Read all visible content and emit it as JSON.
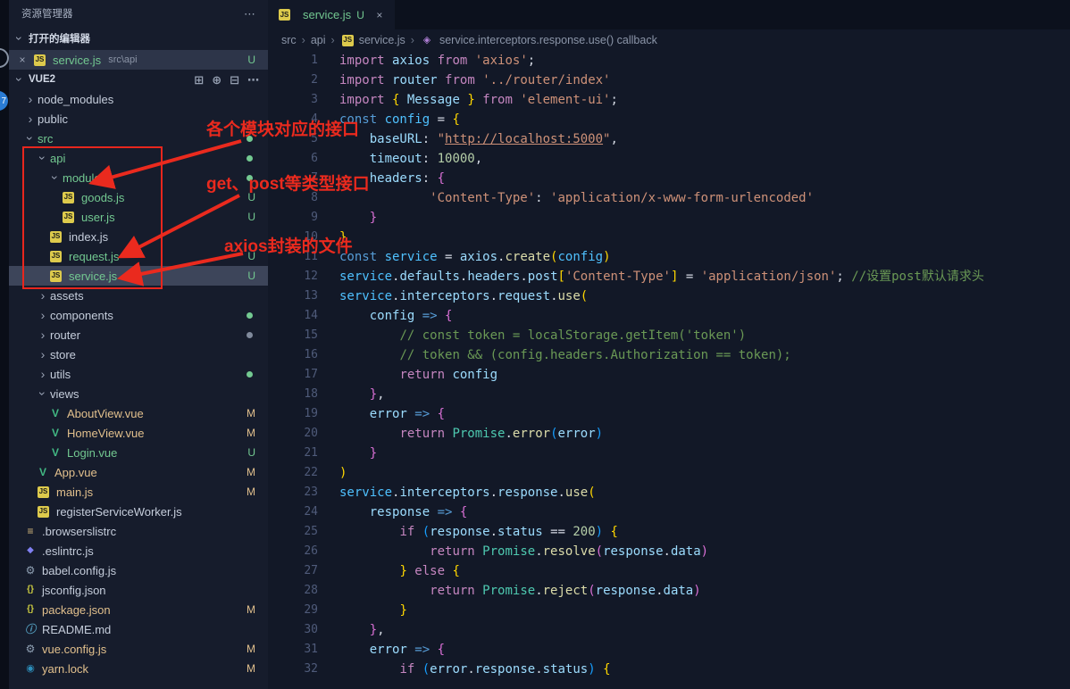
{
  "colors": {
    "annotation_red": "#ea2a1e",
    "git_untracked_green": "#73c991",
    "git_modified_gold": "#e2c08d",
    "selection_bg": "#3d455a",
    "js_icon_yellow": "#ddca4c",
    "vue_icon_green": "#42b883"
  },
  "activity_bar": {
    "badge": "7"
  },
  "icons": {
    "more": "⋯",
    "new_file": "⊞",
    "new_folder": "⊕",
    "collapse_folders": "⊟",
    "close": "×",
    "chevron": "›",
    "js_file": "JS",
    "vue_file": "V",
    "json_file": "{}",
    "gear_file": "⚙",
    "eslint_file": "◆",
    "list_file": "≡",
    "info_file": "ⓘ",
    "yarn_file": "◉",
    "symbol": "◈",
    "breadcrumb_sep": "›"
  },
  "sidebar": {
    "title": "资源管理器",
    "open_editors": {
      "label": "打开的编辑器",
      "items": [
        {
          "name": "service.js",
          "path": "src\\api",
          "badge": "U"
        }
      ]
    },
    "project": {
      "name": "VUE2",
      "tree": [
        {
          "depth": 0,
          "kind": "folder",
          "expanded": false,
          "label": "node_modules"
        },
        {
          "depth": 0,
          "kind": "folder",
          "expanded": false,
          "label": "public"
        },
        {
          "depth": 0,
          "kind": "folder",
          "expanded": true,
          "label": "src",
          "color": "green",
          "dot": "green"
        },
        {
          "depth": 1,
          "kind": "folder",
          "expanded": true,
          "label": "api",
          "color": "green",
          "dot": "green"
        },
        {
          "depth": 2,
          "kind": "folder",
          "expanded": true,
          "label": "modules",
          "color": "green",
          "dot": "green"
        },
        {
          "depth": 3,
          "kind": "file",
          "icon": "js_file",
          "label": "goods.js",
          "color": "green",
          "badge": "U"
        },
        {
          "depth": 3,
          "kind": "file",
          "icon": "js_file",
          "label": "user.js",
          "color": "green",
          "badge": "U"
        },
        {
          "depth": 2,
          "kind": "file",
          "icon": "js_file",
          "label": "index.js"
        },
        {
          "depth": 2,
          "kind": "file",
          "icon": "js_file",
          "label": "request.js",
          "color": "green",
          "badge": "U"
        },
        {
          "depth": 2,
          "kind": "file",
          "icon": "js_file",
          "label": "service.js",
          "color": "green",
          "badge": "U",
          "selected": true
        },
        {
          "depth": 1,
          "kind": "folder",
          "expanded": false,
          "label": "assets"
        },
        {
          "depth": 1,
          "kind": "folder",
          "expanded": false,
          "label": "components",
          "dot": "green"
        },
        {
          "depth": 1,
          "kind": "folder",
          "expanded": false,
          "label": "router",
          "dot": "grey"
        },
        {
          "depth": 1,
          "kind": "folder",
          "expanded": false,
          "label": "store"
        },
        {
          "depth": 1,
          "kind": "folder",
          "expanded": false,
          "label": "utils",
          "dot": "green"
        },
        {
          "depth": 1,
          "kind": "folder",
          "expanded": true,
          "label": "views"
        },
        {
          "depth": 2,
          "kind": "file",
          "icon": "vue_file",
          "label": "AboutView.vue",
          "color": "gold",
          "badge": "M"
        },
        {
          "depth": 2,
          "kind": "file",
          "icon": "vue_file",
          "label": "HomeView.vue",
          "color": "gold",
          "badge": "M"
        },
        {
          "depth": 2,
          "kind": "file",
          "icon": "vue_file",
          "label": "Login.vue",
          "color": "green",
          "badge": "U"
        },
        {
          "depth": 1,
          "kind": "file",
          "icon": "vue_file",
          "label": "App.vue",
          "color": "gold",
          "badge": "M"
        },
        {
          "depth": 1,
          "kind": "file",
          "icon": "js_file",
          "label": "main.js",
          "color": "gold",
          "badge": "M"
        },
        {
          "depth": 1,
          "kind": "file",
          "icon": "js_file",
          "label": "registerServiceWorker.js"
        },
        {
          "depth": 0,
          "kind": "file",
          "icon": "list_file",
          "label": ".browserslistrc"
        },
        {
          "depth": 0,
          "kind": "file",
          "icon": "eslint_file",
          "label": ".eslintrc.js"
        },
        {
          "depth": 0,
          "kind": "file",
          "icon": "gear_file",
          "label": "babel.config.js"
        },
        {
          "depth": 0,
          "kind": "file",
          "icon": "json_file",
          "label": "jsconfig.json"
        },
        {
          "depth": 0,
          "kind": "file",
          "icon": "json_file",
          "label": "package.json",
          "color": "gold",
          "badge": "M"
        },
        {
          "depth": 0,
          "kind": "file",
          "icon": "info_file",
          "label": "README.md"
        },
        {
          "depth": 0,
          "kind": "file",
          "icon": "gear_file",
          "label": "vue.config.js",
          "color": "gold",
          "badge": "M"
        },
        {
          "depth": 0,
          "kind": "file",
          "icon": "yarn_file",
          "label": "yarn.lock",
          "color": "gold",
          "badge": "M"
        }
      ]
    }
  },
  "annotations": [
    {
      "text": "各个模块对应的接口"
    },
    {
      "text": "get、post等类型接口"
    },
    {
      "text": "axios封装的文件"
    }
  ],
  "editor": {
    "tab": {
      "label": "service.js",
      "badge": "U"
    },
    "breadcrumbs": [
      {
        "label": "src"
      },
      {
        "label": "api"
      },
      {
        "label": "service.js",
        "icon": "js_file"
      },
      {
        "label": "service.interceptors.response.use() callback",
        "icon": "symbol"
      }
    ],
    "lines": [
      [
        [
          "import ",
          "kw"
        ],
        [
          "axios ",
          "var"
        ],
        [
          "from ",
          "kw"
        ],
        [
          "'axios'",
          "str"
        ],
        [
          ";",
          "pn"
        ]
      ],
      [
        [
          "import ",
          "kw"
        ],
        [
          "router ",
          "var"
        ],
        [
          "from ",
          "kw"
        ],
        [
          "'../router/index'",
          "str"
        ]
      ],
      [
        [
          "import ",
          "kw"
        ],
        [
          "{ ",
          "b1"
        ],
        [
          "Message",
          "var"
        ],
        [
          " } ",
          "b1"
        ],
        [
          "from ",
          "kw"
        ],
        [
          "'element-ui'",
          "str"
        ],
        [
          ";",
          "pn"
        ]
      ],
      [
        [
          "const ",
          "cd"
        ],
        [
          "config ",
          "cvar"
        ],
        [
          "= ",
          "pn"
        ],
        [
          "{",
          "b1"
        ]
      ],
      [
        [
          "    ",
          "pn"
        ],
        [
          "baseURL",
          "var"
        ],
        [
          ": ",
          "pn"
        ],
        [
          "\"",
          "str"
        ],
        [
          "http://localhost:5000",
          "link"
        ],
        [
          "\"",
          "str"
        ],
        [
          ",",
          "pn"
        ]
      ],
      [
        [
          "    ",
          "pn"
        ],
        [
          "timeout",
          "var"
        ],
        [
          ": ",
          "pn"
        ],
        [
          "10000",
          "num"
        ],
        [
          ",",
          "pn"
        ]
      ],
      [
        [
          "    ",
          "pn"
        ],
        [
          "headers",
          "var"
        ],
        [
          ": ",
          "pn"
        ],
        [
          "{",
          "b2"
        ]
      ],
      [
        [
          "            ",
          "pn"
        ],
        [
          "'Content-Type'",
          "str"
        ],
        [
          ": ",
          "pn"
        ],
        [
          "'application/x-www-form-urlencoded'",
          "str"
        ]
      ],
      [
        [
          "    ",
          "pn"
        ],
        [
          "}",
          "b2"
        ]
      ],
      [
        [
          "}",
          "b1"
        ]
      ],
      [
        [
          "const ",
          "cd"
        ],
        [
          "service ",
          "cvar"
        ],
        [
          "= ",
          "pn"
        ],
        [
          "axios",
          "var"
        ],
        [
          ".",
          "pn"
        ],
        [
          "create",
          "fn"
        ],
        [
          "(",
          "b1"
        ],
        [
          "config",
          "cvar"
        ],
        [
          ")",
          "b1"
        ]
      ],
      [
        [
          "service",
          "cvar"
        ],
        [
          ".",
          "pn"
        ],
        [
          "defaults",
          "var"
        ],
        [
          ".",
          "pn"
        ],
        [
          "headers",
          "var"
        ],
        [
          ".",
          "pn"
        ],
        [
          "post",
          "var"
        ],
        [
          "[",
          "b1"
        ],
        [
          "'Content-Type'",
          "str"
        ],
        [
          "]",
          "b1"
        ],
        [
          " = ",
          "pn"
        ],
        [
          "'application/json'",
          "str"
        ],
        [
          "; ",
          "pn"
        ],
        [
          "//设置post默认请求头",
          "cmt"
        ]
      ],
      [
        [
          "service",
          "cvar"
        ],
        [
          ".",
          "pn"
        ],
        [
          "interceptors",
          "var"
        ],
        [
          ".",
          "pn"
        ],
        [
          "request",
          "var"
        ],
        [
          ".",
          "pn"
        ],
        [
          "use",
          "fn"
        ],
        [
          "(",
          "b1"
        ]
      ],
      [
        [
          "    ",
          "pn"
        ],
        [
          "config ",
          "var"
        ],
        [
          "=> ",
          "cd"
        ],
        [
          "{",
          "b2"
        ]
      ],
      [
        [
          "        ",
          "pn"
        ],
        [
          "// const token = localStorage.getItem('token')",
          "cmt"
        ]
      ],
      [
        [
          "        ",
          "pn"
        ],
        [
          "// token && (config.headers.Authorization == token);",
          "cmt"
        ]
      ],
      [
        [
          "        ",
          "pn"
        ],
        [
          "return ",
          "kw"
        ],
        [
          "config",
          "var"
        ]
      ],
      [
        [
          "    ",
          "pn"
        ],
        [
          "}",
          "b2"
        ],
        [
          ",",
          "pn"
        ]
      ],
      [
        [
          "    ",
          "pn"
        ],
        [
          "error ",
          "var"
        ],
        [
          "=> ",
          "cd"
        ],
        [
          "{",
          "b2"
        ]
      ],
      [
        [
          "        ",
          "pn"
        ],
        [
          "return ",
          "kw"
        ],
        [
          "Promise",
          "cls"
        ],
        [
          ".",
          "pn"
        ],
        [
          "error",
          "fn"
        ],
        [
          "(",
          "b3"
        ],
        [
          "error",
          "var"
        ],
        [
          ")",
          "b3"
        ]
      ],
      [
        [
          "    ",
          "pn"
        ],
        [
          "}",
          "b2"
        ]
      ],
      [
        [
          ")",
          "b1"
        ]
      ],
      [
        [
          "service",
          "cvar"
        ],
        [
          ".",
          "pn"
        ],
        [
          "interceptors",
          "var"
        ],
        [
          ".",
          "pn"
        ],
        [
          "response",
          "var"
        ],
        [
          ".",
          "pn"
        ],
        [
          "use",
          "fn"
        ],
        [
          "(",
          "b1"
        ]
      ],
      [
        [
          "    ",
          "pn"
        ],
        [
          "response ",
          "var"
        ],
        [
          "=> ",
          "cd"
        ],
        [
          "{",
          "b2"
        ]
      ],
      [
        [
          "        ",
          "pn"
        ],
        [
          "if ",
          "kw"
        ],
        [
          "(",
          "b3"
        ],
        [
          "response",
          "var"
        ],
        [
          ".",
          "pn"
        ],
        [
          "status ",
          "var"
        ],
        [
          "== ",
          "pn"
        ],
        [
          "200",
          "num"
        ],
        [
          ")",
          "b3"
        ],
        [
          " ",
          "pn"
        ],
        [
          "{",
          "b1"
        ]
      ],
      [
        [
          "            ",
          "pn"
        ],
        [
          "return ",
          "kw"
        ],
        [
          "Promise",
          "cls"
        ],
        [
          ".",
          "pn"
        ],
        [
          "resolve",
          "fn"
        ],
        [
          "(",
          "b2"
        ],
        [
          "response",
          "var"
        ],
        [
          ".",
          "pn"
        ],
        [
          "data",
          "var"
        ],
        [
          ")",
          "b2"
        ]
      ],
      [
        [
          "        ",
          "pn"
        ],
        [
          "} ",
          "b1"
        ],
        [
          "else ",
          "kw"
        ],
        [
          "{",
          "b1"
        ]
      ],
      [
        [
          "            ",
          "pn"
        ],
        [
          "return ",
          "kw"
        ],
        [
          "Promise",
          "cls"
        ],
        [
          ".",
          "pn"
        ],
        [
          "reject",
          "fn"
        ],
        [
          "(",
          "b2"
        ],
        [
          "response",
          "var"
        ],
        [
          ".",
          "pn"
        ],
        [
          "data",
          "var"
        ],
        [
          ")",
          "b2"
        ]
      ],
      [
        [
          "        ",
          "pn"
        ],
        [
          "}",
          "b1"
        ]
      ],
      [
        [
          "    ",
          "pn"
        ],
        [
          "}",
          "b2"
        ],
        [
          ",",
          "pn"
        ]
      ],
      [
        [
          "    ",
          "pn"
        ],
        [
          "error ",
          "var"
        ],
        [
          "=> ",
          "cd"
        ],
        [
          "{",
          "b2"
        ]
      ],
      [
        [
          "        ",
          "pn"
        ],
        [
          "if ",
          "kw"
        ],
        [
          "(",
          "b3"
        ],
        [
          "error",
          "var"
        ],
        [
          ".",
          "pn"
        ],
        [
          "response",
          "var"
        ],
        [
          ".",
          "pn"
        ],
        [
          "status",
          "var"
        ],
        [
          ")",
          "b3"
        ],
        [
          " ",
          "pn"
        ],
        [
          "{",
          "b1"
        ]
      ]
    ]
  }
}
